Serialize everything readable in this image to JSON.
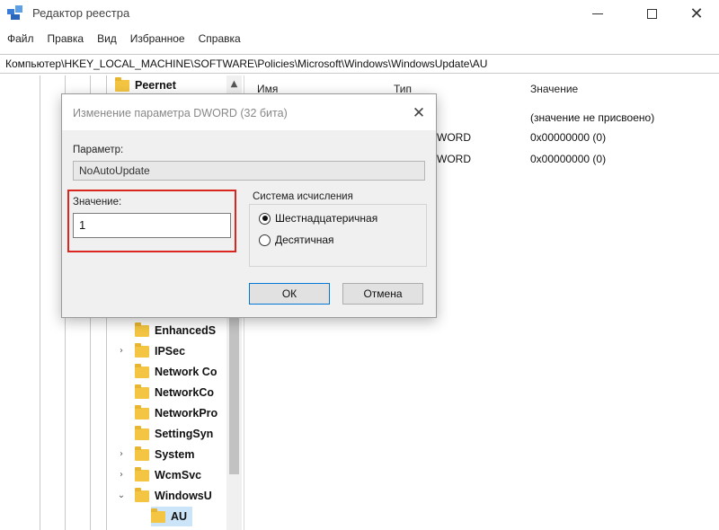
{
  "window": {
    "title": "Редактор реестра",
    "minimize_icon": "minimize-icon",
    "maximize_icon": "maximize-icon",
    "close_glyph": "✕"
  },
  "menu": [
    "Файл",
    "Правка",
    "Вид",
    "Избранное",
    "Справка"
  ],
  "address": "Компьютер\\HKEY_LOCAL_MACHINE\\SOFTWARE\\Policies\\Microsoft\\Windows\\WindowsUpdate\\AU",
  "tree": {
    "top_item": "Peernet",
    "items": [
      "EnhancedS",
      "IPSec",
      "Network Co",
      "NetworkCo",
      "NetworkPro",
      "SettingSyn",
      "System",
      "WcmSvc",
      "WindowsU",
      "AU"
    ],
    "expander_closed": "›",
    "expander_open": "⌄",
    "scroll_up": "▲"
  },
  "values_pane": {
    "columns": {
      "name": "Имя",
      "type": "Тип",
      "data": "Значение"
    },
    "rows": [
      {
        "type": "",
        "data": "(значение не присвоено)"
      },
      {
        "type": "WORD",
        "data": "0x00000000 (0)"
      },
      {
        "type": "WORD",
        "data": "0x00000000 (0)"
      }
    ]
  },
  "dialog": {
    "title": "Изменение параметра DWORD (32 бита)",
    "close_glyph": "✕",
    "param_label": "Параметр:",
    "param_value": "NoAutoUpdate",
    "value_label": "Значение:",
    "value": "1",
    "radix_label": "Система исчисления",
    "radix_hex": "Шестнадцатеричная",
    "radix_dec": "Десятичная",
    "radix_selected": "hex",
    "ok": "ОК",
    "cancel": "Отмена"
  },
  "colors": {
    "highlight": "#d9271f",
    "folder": "#f4c542",
    "accent": "#0078d7"
  }
}
